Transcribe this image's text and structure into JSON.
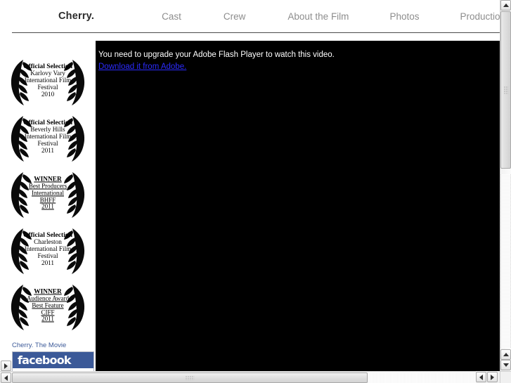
{
  "nav": {
    "brand": "Cherry.",
    "items": [
      {
        "label": "Cast"
      },
      {
        "label": "Crew"
      },
      {
        "label": "About the Film"
      },
      {
        "label": "Photos"
      },
      {
        "label": "Production Notes"
      }
    ]
  },
  "sidebar": {
    "laurels": [
      {
        "type": "official",
        "title": "Official Selection",
        "lines": [
          "Karlovy Vary",
          "International Film",
          "Festival",
          "2010"
        ]
      },
      {
        "type": "official",
        "title": "Official Selection",
        "lines": [
          "Beverly Hills",
          "International Film",
          "Festival",
          "2011"
        ]
      },
      {
        "type": "winner",
        "title": "WINNER",
        "lines": [
          "Best Producers",
          "International ",
          "BHFF",
          "2011"
        ]
      },
      {
        "type": "official",
        "title": "Official Selection",
        "lines": [
          "Charleston",
          "International Film",
          "Festival",
          "2011"
        ]
      },
      {
        "type": "winner",
        "title": "WINNER",
        "lines": [
          "Audience Award",
          "Best Feature",
          "CIFF",
          "2011"
        ]
      }
    ],
    "facebook": {
      "caption": "Cherry. The Movie",
      "logo": "facebook"
    }
  },
  "video": {
    "message": "You need to upgrade your Adobe Flash Player to watch this video.",
    "link_text": "Download it from Adobe.",
    "background": "#000000",
    "link_color": "#2b2bff"
  },
  "colors": {
    "brand_text": "#2b2b2b",
    "nav_text": "#8d8d8d",
    "facebook_blue": "#3b5998"
  },
  "icons": {
    "scroll_up": "▲",
    "scroll_down": "▼",
    "scroll_left": "◀",
    "scroll_right": "▶"
  }
}
